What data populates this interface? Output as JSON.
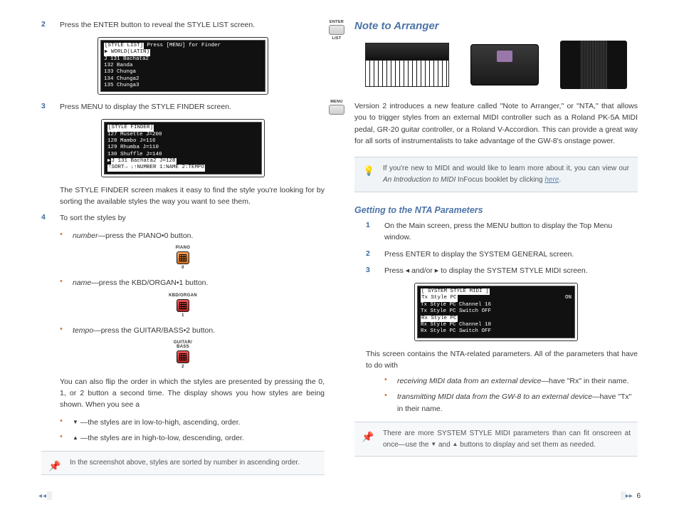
{
  "left": {
    "steps": {
      "s2": {
        "num": "2",
        "text": "Press the ENTER button to reveal the STYLE LIST screen."
      },
      "s3": {
        "num": "3",
        "text": "Press MENU to display the STYLE FINDER screen."
      },
      "finder_para": "The STYLE FINDER screen makes it easy to find the style you're looking for by sorting the available styles the way you want to see them.",
      "s4": {
        "num": "4",
        "text": "To sort the styles by"
      }
    },
    "lcd1": {
      "l1a": "[STYLE LIST]",
      "l1b": " Press [MENU] for Finder",
      "l2": "▶ WORLD(LATIN)",
      "l3": "J 131 Bachata2",
      "l4": "  132 Banda",
      "l5": "  133 Chunga",
      "l6": "  134 Chunga2",
      "l7": "  135 Chunga3"
    },
    "lcd2": {
      "l1": "[STYLE FINDER]",
      "l2": "  127 Musette           J=200",
      "l3": "  128 Mambo             J=116",
      "l4": "  129 Rhumba            J=110",
      "l5": "  130 Shuffle           J=140",
      "l6a": "▶",
      "l6b": "J 131 Bachata2          J=128",
      "l7a": "↑SORT→  ↓↑NUMBER  1:NAME    2:TEMPO"
    },
    "sort": {
      "number": {
        "term": "number",
        "text": "—press the PIANO•0 button."
      },
      "name": {
        "term": "name",
        "text": "—press the KBD/ORGAN•1 button."
      },
      "tempo": {
        "term": "tempo",
        "text": "—press the GUITAR/BASS•2 button."
      }
    },
    "icons": {
      "piano": "PIANO",
      "piano_num": "0",
      "kbd": "KBD/ORGAN",
      "kbd_num": "1",
      "gb1": "GUITAR/",
      "gb2": "BASS",
      "gb_num": "2"
    },
    "flip_para": "You can also flip the order in which the styles are presented by pressing the 0, 1, or 2 button a second time. The display shows you how styles are being shown. When you see a",
    "asc": "—the styles are in low-to-high, ascending, order.",
    "desc": "—the styles are in high-to-low, descending, order.",
    "note": "In the screenshot above, styles are sorted by number in ascending order.",
    "btn_enter": "ENTER",
    "btn_list": "LIST",
    "btn_menu": "MENU"
  },
  "right": {
    "heading": "Note to Arranger",
    "intro": "Version 2 introduces a new feature called \"Note to Arranger,\" or \"NTA,\" that allows you to trigger styles from an external MIDI controller such as a Roland PK-5A MIDI pedal, GR-20 guitar controller, or a Roland V-Accordion. This can provide a great way for all sorts of instrumentalists to take advantage of the GW-8's onstage power.",
    "tip_a": "If you're new to MIDI and would like to learn more about it, you can view our ",
    "tip_ital": "An Introduction to MIDI",
    "tip_b": " InFocus booklet by clicking ",
    "tip_link": "here",
    "tip_c": ".",
    "sub": "Getting to the NTA Parameters",
    "steps": {
      "s1": {
        "num": "1",
        "text": "On the Main screen, press the MENU button to display the Top Menu window."
      },
      "s2": {
        "num": "2",
        "text": "Press ENTER to display the SYSTEM GENERAL screen."
      },
      "s3": {
        "num": "3",
        "a": "Press ",
        "b": " and/or ",
        "c": " to display the SYSTEM STYLE MIDI screen."
      }
    },
    "lcd3": {
      "l1": "[ SYSTEM STYLE MIDI ]",
      "l2a": " Tx Style PC ",
      "l2b": "ON",
      "l3": "  Tx Style PC Channel         16",
      "l4": "  Tx Style PC Switch         OFF",
      "l5": "  Rx Style PC                   ",
      "l6": "  Rx Style PC Channel         10",
      "l7": "  Rx Style PC Switch         OFF"
    },
    "after_para": "This screen contains the NTA-related parameters. All of the parameters that have to do with",
    "rx": {
      "term": "receiving MIDI data from an external device",
      "text": "—have \"Rx\" in their name."
    },
    "tx": {
      "term": "transmitting MIDI data from the GW-8 to an external device",
      "text": "—have \"Tx\" in their name."
    },
    "note2a": "There are more SYSTEM STYLE MIDI parameters than can fit onscreen at once—use the ",
    "note2b": " and ",
    "note2c": " buttons to display and set them as needed."
  },
  "footer": {
    "page": "6"
  }
}
